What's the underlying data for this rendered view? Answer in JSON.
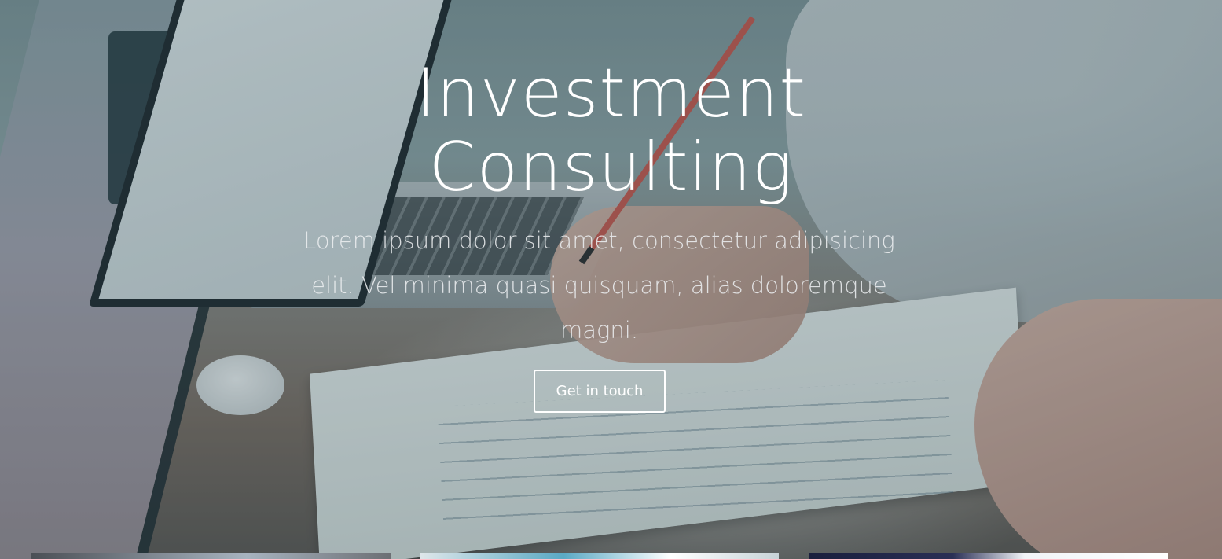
{
  "hero": {
    "title_line_1": "Investment",
    "title_line_2": "Consulting",
    "subtitle": "Lorem ipsum dolor sit amet, consectetur adipisicing elit. Vel minima quasi quisquam, alias doloremque magni.",
    "cta_label": "Get in touch"
  },
  "colors": {
    "text": "#ffffff",
    "subtitle_text": "#eceef0",
    "overlay": "#284650"
  }
}
